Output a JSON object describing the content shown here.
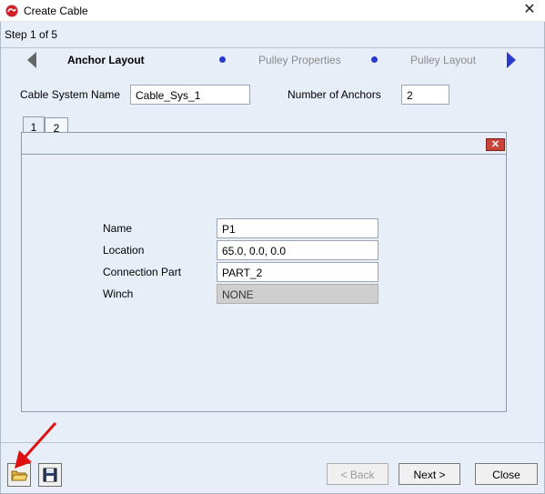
{
  "window": {
    "title": "Create Cable",
    "close_glyph": "✕"
  },
  "wizard": {
    "step_indicator": "Step 1 of 5",
    "steps": [
      {
        "label": "Anchor Layout",
        "state": "active"
      },
      {
        "label": "Pulley Properties",
        "state": "inactive"
      },
      {
        "label": "Pulley Layout",
        "state": "inactive"
      }
    ],
    "colors": {
      "accent": "#2a3bd1",
      "inactive_text": "#8c8c8c"
    }
  },
  "form": {
    "cable_system_name_label": "Cable System Name",
    "cable_system_name_value": "Cable_Sys_1",
    "number_of_anchors_label": "Number of Anchors",
    "number_of_anchors_value": "2"
  },
  "anchor_tabs": [
    {
      "label": "1",
      "selected": true
    },
    {
      "label": "2",
      "selected": false
    }
  ],
  "anchor": {
    "name_label": "Name",
    "name_value": "P1",
    "location_label": "Location",
    "location_value": "65.0, 0.0, 0.0",
    "connection_part_label": "Connection Part",
    "connection_part_value": "PART_2",
    "winch_label": "Winch",
    "winch_value": "NONE"
  },
  "footer": {
    "open_icon": "folder-open-icon",
    "save_icon": "floppy-save-icon",
    "back_label": "< Back",
    "next_label": "Next >",
    "close_label": "Close"
  }
}
